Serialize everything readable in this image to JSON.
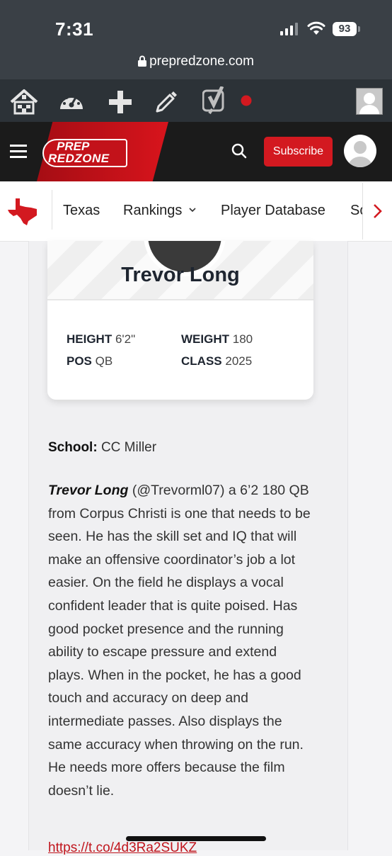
{
  "status_bar": {
    "time": "7:31",
    "battery": "93",
    "url": "prepredzone.com"
  },
  "admin_bar": {
    "icons": [
      "network-home-icon",
      "dashboard-gauge-icon",
      "plus-icon",
      "pencil-icon",
      "yoast-y-icon",
      "notification-dot-icon",
      "user-avatar-icon"
    ],
    "notification_color": "#d31920"
  },
  "header": {
    "logo_line1": "PREP",
    "logo_line2": "REDZONE",
    "subscribe_label": "Subscribe",
    "brand_color": "#d31920"
  },
  "nav": {
    "items": [
      "Texas",
      "Rankings",
      "Player Database",
      "Sc"
    ]
  },
  "player": {
    "name": "Trevor Long",
    "height_label": "HEIGHT",
    "height": "6'2\"",
    "weight_label": "WEIGHT",
    "weight": "180",
    "pos_label": "POS",
    "pos": "QB",
    "class_label": "CLASS",
    "class": "2025"
  },
  "article": {
    "school_label": "School:",
    "school": "CC Miller",
    "bio_name": "Trevor Long",
    "bio_text": " (@Trevorml07) a 6’2 180 QB from Corpus Christi is one that needs to be seen. He has the skill set and IQ that will make an offensive coordinator’s job a lot easier. On the field he displays a vocal confident leader that is quite poised. Has good pocket presence and the running ability to escape pressure and extend plays. When in the pocket, he has a good touch and accuracy on deep and intermediate passes. Also displays the same accuracy when throwing on the run. He needs more offers because the film doesn’t lie.",
    "link": "https://t.co/4d3Ra2SUKZ"
  }
}
